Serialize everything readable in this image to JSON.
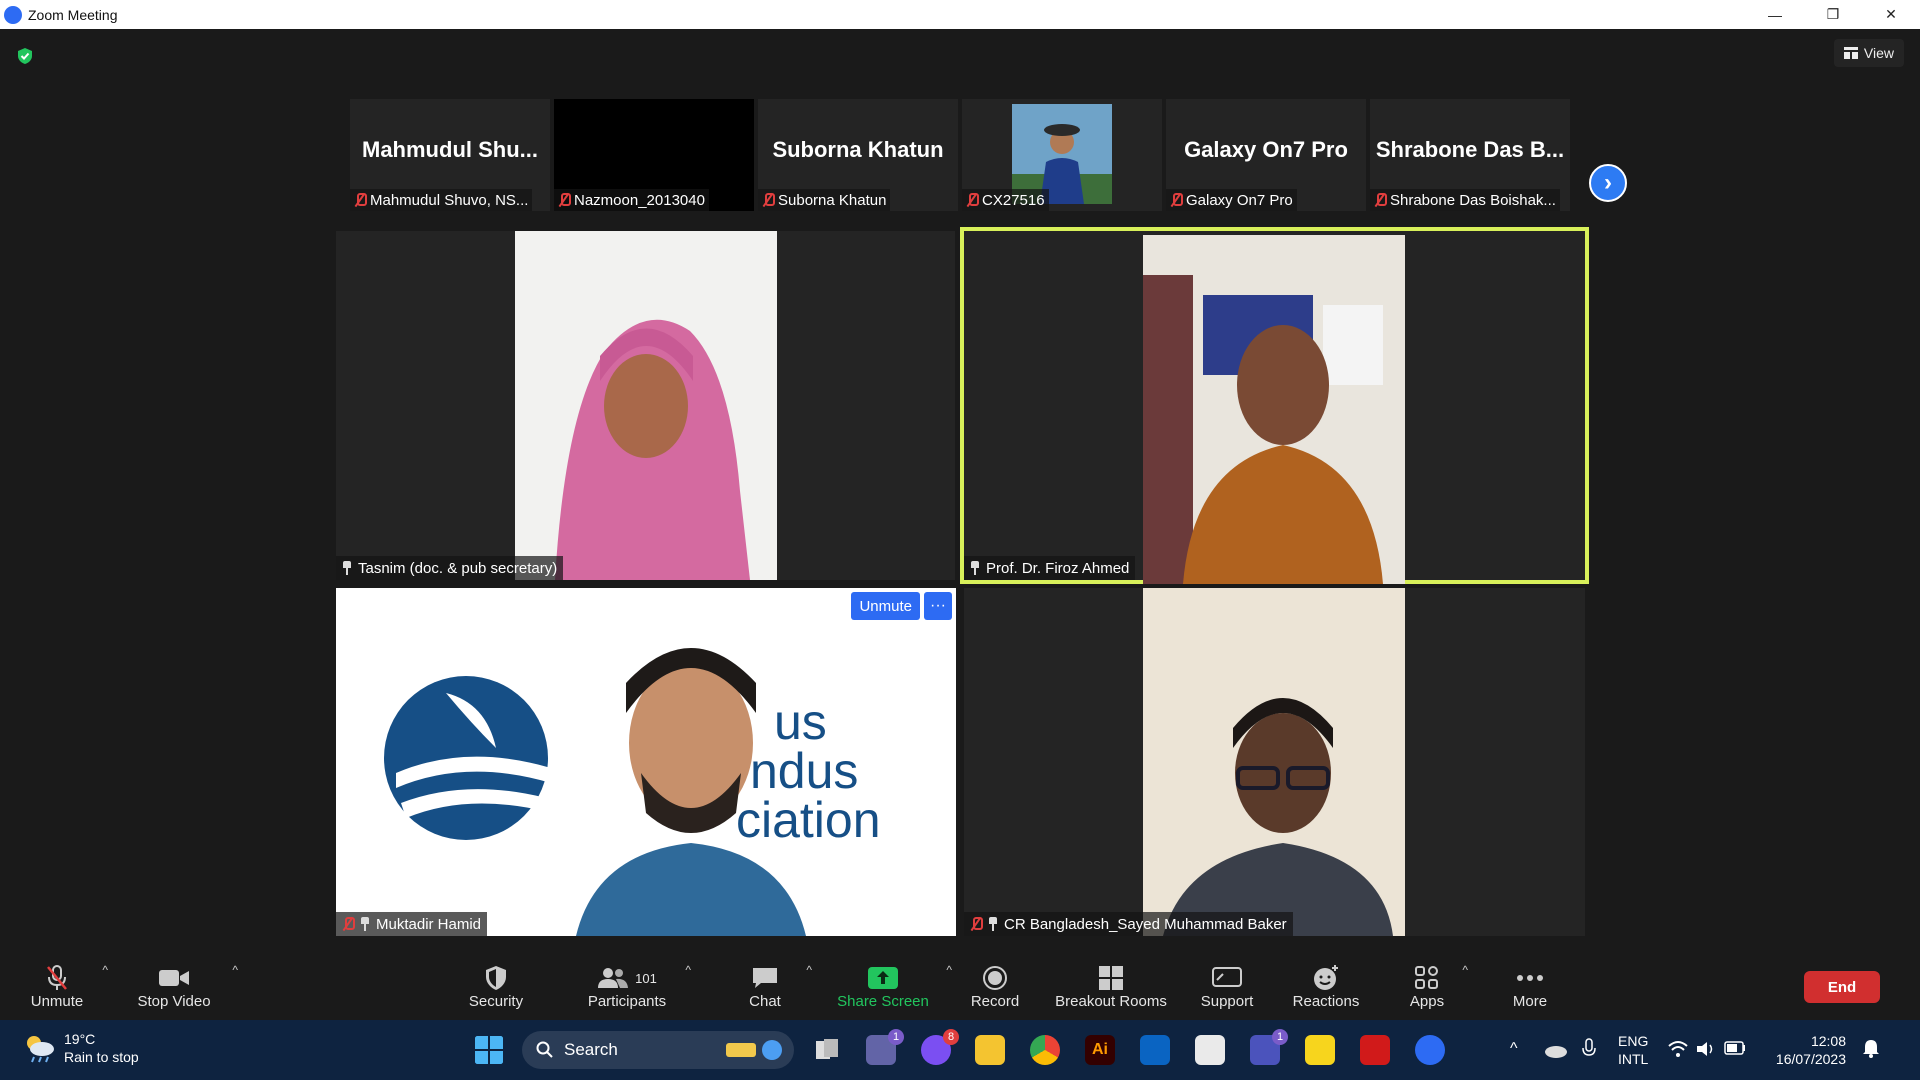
{
  "window": {
    "title": "Zoom Meeting",
    "minimize": "—",
    "restore": "❐",
    "close": "✕"
  },
  "view_button": {
    "label": "View"
  },
  "thumbnails": [
    {
      "big": "Mahmudul  Shu...",
      "label": "Mahmudul Shuvo, NS..."
    },
    {
      "big": "",
      "label": "Nazmoon_2013040"
    },
    {
      "big": "Suborna Khatun",
      "label": "Suborna Khatun"
    },
    {
      "big": "",
      "label": "CX27516"
    },
    {
      "big": "Galaxy On7 Pro",
      "label": "Galaxy On7 Pro"
    },
    {
      "big": "Shrabone  Das  B...",
      "label": "Shrabone Das Boishak..."
    }
  ],
  "tiles": {
    "tasnim": {
      "label": "Tasnim (doc. & pub secretary)"
    },
    "firoz": {
      "label": "Prof. Dr. Firoz Ahmed"
    },
    "muktadir": {
      "label": "Muktadir Hamid",
      "unmute": "Unmute",
      "more": "···",
      "backdrop_lines": [
        "us",
        "ndus",
        "ciation"
      ]
    },
    "sayed": {
      "label": "CR Bangladesh_Sayed Muhammad Baker"
    }
  },
  "toolbar": {
    "unmute": "Unmute",
    "stop_video": "Stop Video",
    "security": "Security",
    "participants": "Participants",
    "participants_count": "101",
    "chat": "Chat",
    "share_screen": "Share Screen",
    "record": "Record",
    "breakout_rooms": "Breakout Rooms",
    "support": "Support",
    "reactions": "Reactions",
    "apps": "Apps",
    "more": "More",
    "end": "End"
  },
  "taskbar": {
    "temperature": "19°C",
    "weather": "Rain to stop",
    "search_placeholder": "Search",
    "lang_top": "ENG",
    "lang_bottom": "INTL",
    "time": "12:08",
    "date": "16/07/2023",
    "badges": {
      "meet": "1",
      "messenger": "8",
      "teams": "1"
    }
  },
  "colors": {
    "active_speaker": "#d8f05a",
    "share_green": "#22c55e",
    "end_red": "#d12f2f",
    "accent_blue": "#2d6bf3"
  }
}
